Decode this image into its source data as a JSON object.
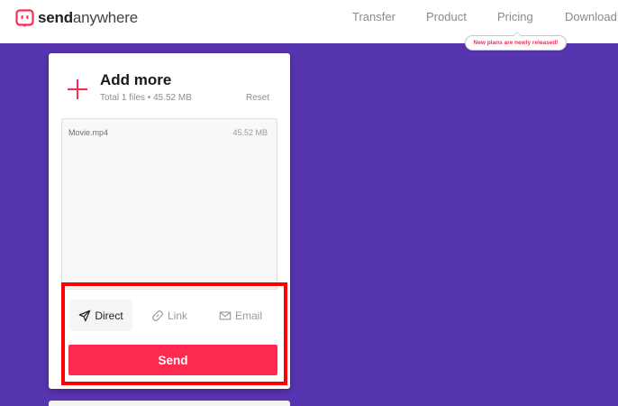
{
  "brand": {
    "name_bold": "send",
    "name_light": "anywhere",
    "color": "#ff2a52"
  },
  "nav": [
    {
      "label": "Transfer"
    },
    {
      "label": "Product"
    },
    {
      "label": "Pricing"
    },
    {
      "label": "Download"
    }
  ],
  "pricing_badge": "New plans are newly released!",
  "card": {
    "title": "Add more",
    "summary": "Total 1 files • 45.52 MB",
    "reset_label": "Reset",
    "files": [
      {
        "name": "Movie.mp4",
        "size": "45.52 MB"
      }
    ],
    "tabs": [
      {
        "label": "Direct",
        "icon": "paper-plane-icon",
        "selected": true
      },
      {
        "label": "Link",
        "icon": "link-icon",
        "selected": false
      },
      {
        "label": "Email",
        "icon": "envelope-icon",
        "selected": false
      }
    ],
    "send_label": "Send"
  },
  "colors": {
    "background": "#5835b0",
    "accent": "#ff2a52",
    "highlight": "#ff0000"
  }
}
